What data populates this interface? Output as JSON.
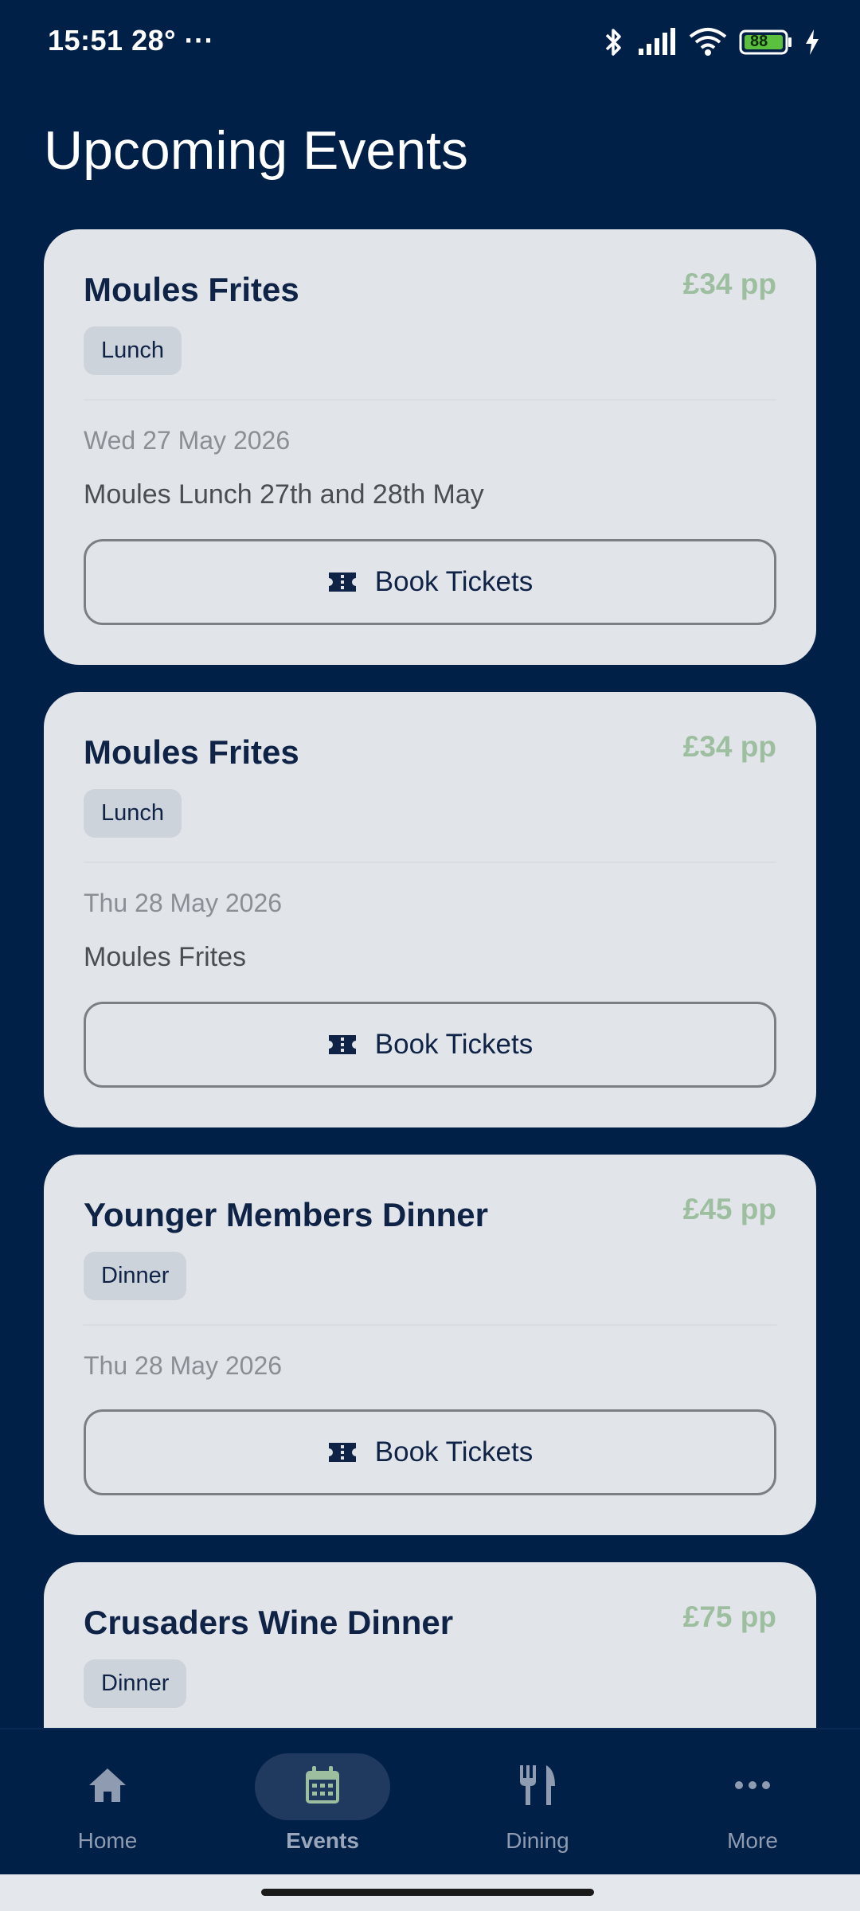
{
  "status_bar": {
    "time": "15:51",
    "temp": "28°",
    "more": "···",
    "battery": "88"
  },
  "page": {
    "title": "Upcoming Events"
  },
  "events": [
    {
      "title": "Moules Frites",
      "price": "£34 pp",
      "category": "Lunch",
      "date": "Wed 27 May 2026",
      "description": "Moules Lunch 27th and 28th May",
      "button_label": "Book Tickets"
    },
    {
      "title": "Moules Frites",
      "price": "£34 pp",
      "category": "Lunch",
      "date": "Thu 28 May 2026",
      "description": "Moules Frites",
      "button_label": "Book Tickets"
    },
    {
      "title": "Younger Members Dinner",
      "price": "£45 pp",
      "category": "Dinner",
      "date": "Thu 28 May 2026",
      "button_label": "Book Tickets"
    },
    {
      "title": "Crusaders Wine Dinner",
      "price": "£75 pp",
      "category": "Dinner"
    }
  ],
  "bottom_nav": {
    "items": [
      {
        "label": "Home",
        "icon": "home-icon",
        "active": false
      },
      {
        "label": "Events",
        "icon": "calendar-icon",
        "active": true
      },
      {
        "label": "Dining",
        "icon": "fork-knife-icon",
        "active": false
      },
      {
        "label": "More",
        "icon": "more-dots-icon",
        "active": false
      }
    ]
  },
  "colors": {
    "background": "#012047",
    "card": "#e1e4e9",
    "title": "#0e2346",
    "price": "#9dbf9f",
    "badge": "#cdd3da",
    "nav_active_pill": "#203a5f"
  }
}
